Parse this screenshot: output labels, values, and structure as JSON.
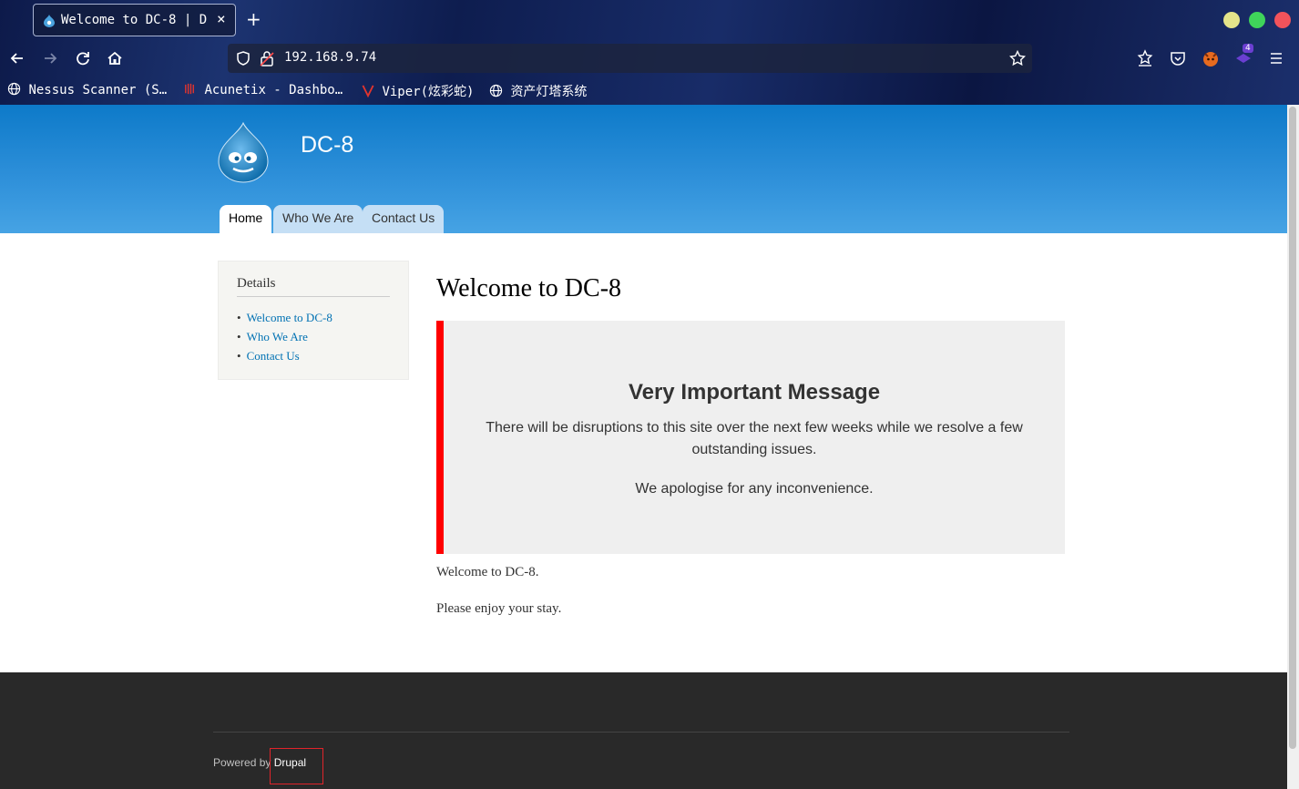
{
  "browser": {
    "tab_title": "Welcome to DC-8 | D",
    "url": "192.168.9.74",
    "extension_badge": "4",
    "bookmarks": [
      {
        "label": "Nessus Scanner (S…",
        "icon": "globe-icon"
      },
      {
        "label": "Acunetix - Dashbo…",
        "icon": "acunetix-icon"
      },
      {
        "label": "Viper(炫彩蛇)",
        "icon": "viper-icon"
      },
      {
        "label": "资产灯塔系统",
        "icon": "globe-icon"
      }
    ]
  },
  "site": {
    "name": "DC-8",
    "nav": [
      {
        "label": "Home",
        "active": true
      },
      {
        "label": "Who We Are",
        "active": false
      },
      {
        "label": "Contact Us",
        "active": false
      }
    ]
  },
  "sidebar": {
    "heading": "Details",
    "links": [
      "Welcome to DC-8",
      "Who We Are",
      "Contact Us"
    ]
  },
  "content": {
    "title": "Welcome to DC-8",
    "notice": {
      "heading": "Very Important Message",
      "line1": "There will be disruptions to this site over the next few weeks while we resolve a few outstanding issues.",
      "line2": "We apologise for any inconvenience."
    },
    "para1": "Welcome to DC-8.",
    "para2": "Please enjoy your stay."
  },
  "footer": {
    "powered_prefix": "Powered by ",
    "powered_link": "Drupal"
  },
  "colors": {
    "accent_link": "#0071b3",
    "notice_border": "#ff0000",
    "footer_bg": "#292929"
  }
}
